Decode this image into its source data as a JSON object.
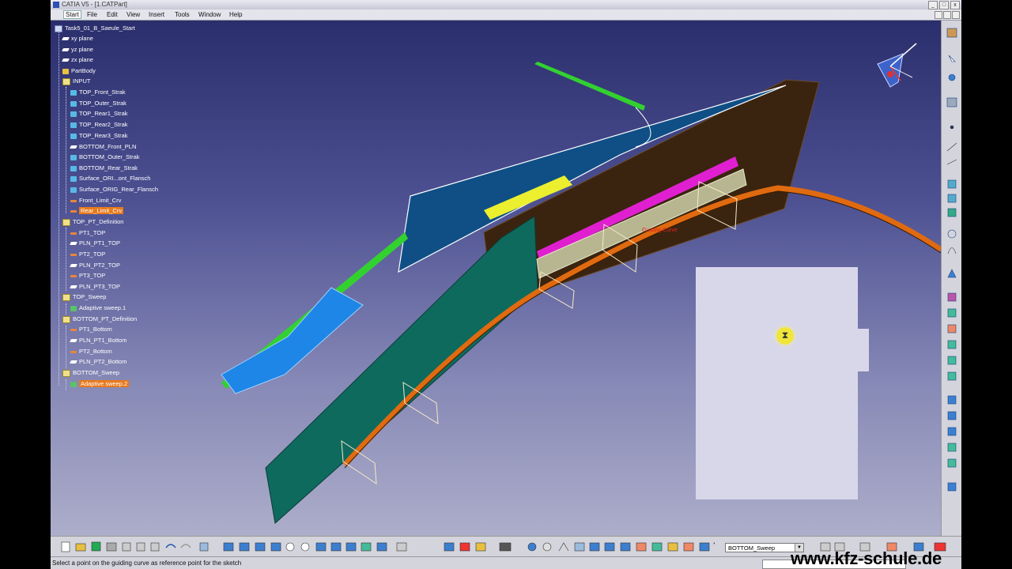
{
  "window": {
    "title": "CATIA V5 - [1.CATPart]",
    "controls": [
      "_",
      "□",
      "x"
    ]
  },
  "menu": {
    "items": [
      "Start",
      "File",
      "Edit",
      "View",
      "Insert",
      "Tools",
      "Window",
      "Help"
    ]
  },
  "tree": {
    "items": [
      {
        "label": "Task5_01_B_Saeule_Start",
        "icon": "part-icon"
      },
      {
        "label": "xy plane",
        "icon": "plane-icon"
      },
      {
        "label": "yz plane",
        "icon": "plane-icon"
      },
      {
        "label": "zx plane",
        "icon": "plane-icon"
      },
      {
        "label": "PartBody",
        "icon": "body-icon"
      },
      {
        "label": "INPUT",
        "icon": "geometrical-set-icon"
      },
      {
        "label": "TOP_Front_Strak",
        "icon": "surface-icon"
      },
      {
        "label": "TOP_Outer_Strak",
        "icon": "surface-icon"
      },
      {
        "label": "TOP_Rear1_Strak",
        "icon": "surface-icon"
      },
      {
        "label": "TOP_Rear2_Strak",
        "icon": "surface-icon"
      },
      {
        "label": "TOP_Rear3_Strak",
        "icon": "surface-icon"
      },
      {
        "label": "BOTTOM_Front_PLN",
        "icon": "plane-icon"
      },
      {
        "label": "BOTTOM_Outer_Strak",
        "icon": "surface-icon"
      },
      {
        "label": "BOTTOM_Rear_Strak",
        "icon": "surface-icon"
      },
      {
        "label": "Surface_ORI...ont_Flansch",
        "icon": "surface-icon"
      },
      {
        "label": "Surface_ORIG_Rear_Flansch",
        "icon": "surface-icon"
      },
      {
        "label": "Front_Limit_Crv",
        "icon": "curve-icon"
      },
      {
        "label": "Rear_Limit_Crv",
        "icon": "curve-icon",
        "highlighted": true
      },
      {
        "label": "TOP_PT_Definition",
        "icon": "geometrical-set-icon"
      },
      {
        "label": "PT1_TOP",
        "icon": "point-icon"
      },
      {
        "label": "PLN_PT1_TOP",
        "icon": "plane-icon"
      },
      {
        "label": "PT2_TOP",
        "icon": "point-icon"
      },
      {
        "label": "PLN_PT2_TOP",
        "icon": "plane-icon"
      },
      {
        "label": "PT3_TOP",
        "icon": "point-icon"
      },
      {
        "label": "PLN_PT3_TOP",
        "icon": "plane-icon"
      },
      {
        "label": "TOP_Sweep",
        "icon": "geometrical-set-icon"
      },
      {
        "label": "Adaptive sweep.1",
        "icon": "sweep-icon"
      },
      {
        "label": "BOTTOM_PT_Definition",
        "icon": "geometrical-set-icon"
      },
      {
        "label": "PT1_Bottom",
        "icon": "point-icon"
      },
      {
        "label": "PLN_PT1_Bottom",
        "icon": "plane-icon"
      },
      {
        "label": "PT2_Bottom",
        "icon": "point-icon"
      },
      {
        "label": "PLN_PT2_Bottom",
        "icon": "plane-icon"
      },
      {
        "label": "BOTTOM_Sweep",
        "icon": "geometrical-set-icon"
      },
      {
        "label": "Adaptive sweep.2",
        "icon": "sweep-icon",
        "highlighted": true
      }
    ]
  },
  "viewport": {
    "annotation": "Guiding Curve",
    "busy_cursor": "hourglass-icon"
  },
  "toolbar": {
    "current_set": "BOTTOM_Sweep"
  },
  "status": {
    "message": "Select a point on the guiding curve as reference point for the sketch"
  },
  "watermark": "www.kfz-schule.de",
  "colors": {
    "background_top": "#2a2e6c",
    "background_bottom": "#adaeca",
    "highlight": "#e87a1e",
    "surface_blue": "#0f4f86",
    "surface_dark": "#3a2410",
    "surface_green": "#0f6a5e",
    "guide_curve": "#e06a10",
    "magenta_curve": "#e020d0"
  }
}
